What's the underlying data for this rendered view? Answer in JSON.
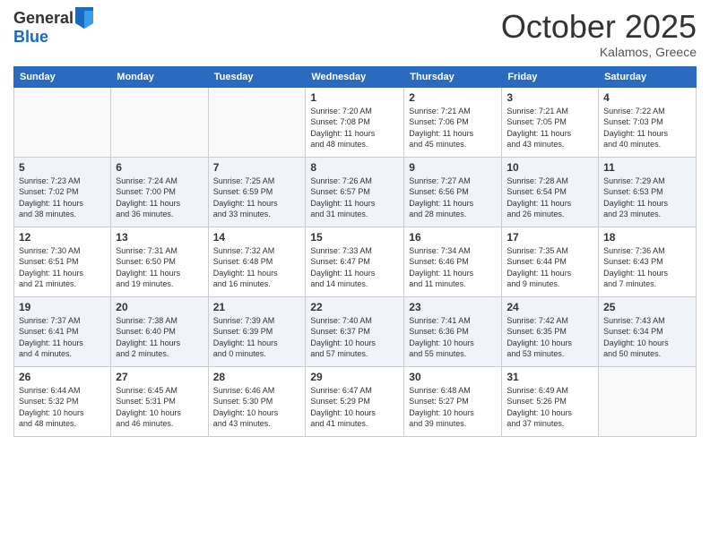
{
  "logo": {
    "general": "General",
    "blue": "Blue"
  },
  "header": {
    "month": "October 2025",
    "location": "Kalamos, Greece"
  },
  "weekdays": [
    "Sunday",
    "Monday",
    "Tuesday",
    "Wednesday",
    "Thursday",
    "Friday",
    "Saturday"
  ],
  "weeks": [
    [
      {
        "day": "",
        "info": ""
      },
      {
        "day": "",
        "info": ""
      },
      {
        "day": "",
        "info": ""
      },
      {
        "day": "1",
        "info": "Sunrise: 7:20 AM\nSunset: 7:08 PM\nDaylight: 11 hours\nand 48 minutes."
      },
      {
        "day": "2",
        "info": "Sunrise: 7:21 AM\nSunset: 7:06 PM\nDaylight: 11 hours\nand 45 minutes."
      },
      {
        "day": "3",
        "info": "Sunrise: 7:21 AM\nSunset: 7:05 PM\nDaylight: 11 hours\nand 43 minutes."
      },
      {
        "day": "4",
        "info": "Sunrise: 7:22 AM\nSunset: 7:03 PM\nDaylight: 11 hours\nand 40 minutes."
      }
    ],
    [
      {
        "day": "5",
        "info": "Sunrise: 7:23 AM\nSunset: 7:02 PM\nDaylight: 11 hours\nand 38 minutes."
      },
      {
        "day": "6",
        "info": "Sunrise: 7:24 AM\nSunset: 7:00 PM\nDaylight: 11 hours\nand 36 minutes."
      },
      {
        "day": "7",
        "info": "Sunrise: 7:25 AM\nSunset: 6:59 PM\nDaylight: 11 hours\nand 33 minutes."
      },
      {
        "day": "8",
        "info": "Sunrise: 7:26 AM\nSunset: 6:57 PM\nDaylight: 11 hours\nand 31 minutes."
      },
      {
        "day": "9",
        "info": "Sunrise: 7:27 AM\nSunset: 6:56 PM\nDaylight: 11 hours\nand 28 minutes."
      },
      {
        "day": "10",
        "info": "Sunrise: 7:28 AM\nSunset: 6:54 PM\nDaylight: 11 hours\nand 26 minutes."
      },
      {
        "day": "11",
        "info": "Sunrise: 7:29 AM\nSunset: 6:53 PM\nDaylight: 11 hours\nand 23 minutes."
      }
    ],
    [
      {
        "day": "12",
        "info": "Sunrise: 7:30 AM\nSunset: 6:51 PM\nDaylight: 11 hours\nand 21 minutes."
      },
      {
        "day": "13",
        "info": "Sunrise: 7:31 AM\nSunset: 6:50 PM\nDaylight: 11 hours\nand 19 minutes."
      },
      {
        "day": "14",
        "info": "Sunrise: 7:32 AM\nSunset: 6:48 PM\nDaylight: 11 hours\nand 16 minutes."
      },
      {
        "day": "15",
        "info": "Sunrise: 7:33 AM\nSunset: 6:47 PM\nDaylight: 11 hours\nand 14 minutes."
      },
      {
        "day": "16",
        "info": "Sunrise: 7:34 AM\nSunset: 6:46 PM\nDaylight: 11 hours\nand 11 minutes."
      },
      {
        "day": "17",
        "info": "Sunrise: 7:35 AM\nSunset: 6:44 PM\nDaylight: 11 hours\nand 9 minutes."
      },
      {
        "day": "18",
        "info": "Sunrise: 7:36 AM\nSunset: 6:43 PM\nDaylight: 11 hours\nand 7 minutes."
      }
    ],
    [
      {
        "day": "19",
        "info": "Sunrise: 7:37 AM\nSunset: 6:41 PM\nDaylight: 11 hours\nand 4 minutes."
      },
      {
        "day": "20",
        "info": "Sunrise: 7:38 AM\nSunset: 6:40 PM\nDaylight: 11 hours\nand 2 minutes."
      },
      {
        "day": "21",
        "info": "Sunrise: 7:39 AM\nSunset: 6:39 PM\nDaylight: 11 hours\nand 0 minutes."
      },
      {
        "day": "22",
        "info": "Sunrise: 7:40 AM\nSunset: 6:37 PM\nDaylight: 10 hours\nand 57 minutes."
      },
      {
        "day": "23",
        "info": "Sunrise: 7:41 AM\nSunset: 6:36 PM\nDaylight: 10 hours\nand 55 minutes."
      },
      {
        "day": "24",
        "info": "Sunrise: 7:42 AM\nSunset: 6:35 PM\nDaylight: 10 hours\nand 53 minutes."
      },
      {
        "day": "25",
        "info": "Sunrise: 7:43 AM\nSunset: 6:34 PM\nDaylight: 10 hours\nand 50 minutes."
      }
    ],
    [
      {
        "day": "26",
        "info": "Sunrise: 6:44 AM\nSunset: 5:32 PM\nDaylight: 10 hours\nand 48 minutes."
      },
      {
        "day": "27",
        "info": "Sunrise: 6:45 AM\nSunset: 5:31 PM\nDaylight: 10 hours\nand 46 minutes."
      },
      {
        "day": "28",
        "info": "Sunrise: 6:46 AM\nSunset: 5:30 PM\nDaylight: 10 hours\nand 43 minutes."
      },
      {
        "day": "29",
        "info": "Sunrise: 6:47 AM\nSunset: 5:29 PM\nDaylight: 10 hours\nand 41 minutes."
      },
      {
        "day": "30",
        "info": "Sunrise: 6:48 AM\nSunset: 5:27 PM\nDaylight: 10 hours\nand 39 minutes."
      },
      {
        "day": "31",
        "info": "Sunrise: 6:49 AM\nSunset: 5:26 PM\nDaylight: 10 hours\nand 37 minutes."
      },
      {
        "day": "",
        "info": ""
      }
    ]
  ]
}
